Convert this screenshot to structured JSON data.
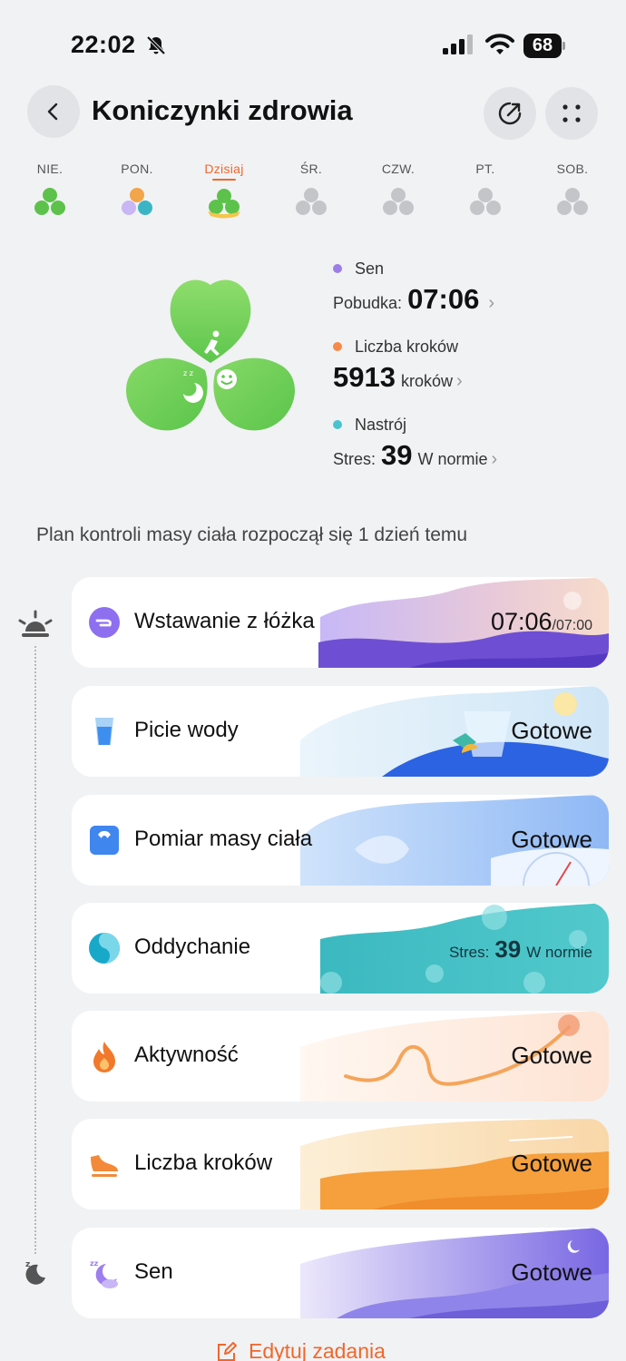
{
  "status_bar": {
    "time": "22:02",
    "battery": "68"
  },
  "header": {
    "title": "Koniczynki zdrowia"
  },
  "days": [
    {
      "label": "NIE.",
      "state": "green"
    },
    {
      "label": "PON.",
      "state": "mixed"
    },
    {
      "label": "Dzisiaj",
      "state": "today"
    },
    {
      "label": "ŚR.",
      "state": "gray"
    },
    {
      "label": "CZW.",
      "state": "gray"
    },
    {
      "label": "PT.",
      "state": "gray"
    },
    {
      "label": "SOB.",
      "state": "gray"
    }
  ],
  "summary": {
    "sleep": {
      "name": "Sen",
      "prefix": "Pobudka:",
      "value": "07:06",
      "color": "#9b7fe6"
    },
    "steps": {
      "name": "Liczba kroków",
      "value": "5913",
      "unit": "kroków",
      "color": "#f58a4b"
    },
    "mood": {
      "name": "Nastrój",
      "prefix": "Stres:",
      "value": "39",
      "unit": "W normie",
      "color": "#4bc3cf"
    }
  },
  "plan_text": "Plan kontroli masy ciała rozpoczął się 1 dzień temu",
  "tasks": {
    "wake": {
      "label": "Wstawanie z łóżka",
      "time": "07:06",
      "target": "/07:00"
    },
    "water": {
      "label": "Picie wody",
      "status": "Gotowe"
    },
    "weight": {
      "label": "Pomiar masy ciała",
      "status": "Gotowe"
    },
    "breath": {
      "label": "Oddychanie",
      "prefix": "Stres:",
      "value": "39",
      "unit": "W normie"
    },
    "activity": {
      "label": "Aktywność",
      "status": "Gotowe"
    },
    "steps": {
      "label": "Liczba kroków",
      "status": "Gotowe"
    },
    "sleep": {
      "label": "Sen",
      "status": "Gotowe"
    }
  },
  "edit_label": "Edytuj zadania",
  "colors": {
    "accent": "#f0672b",
    "clover_green": "#6fcf5c"
  }
}
